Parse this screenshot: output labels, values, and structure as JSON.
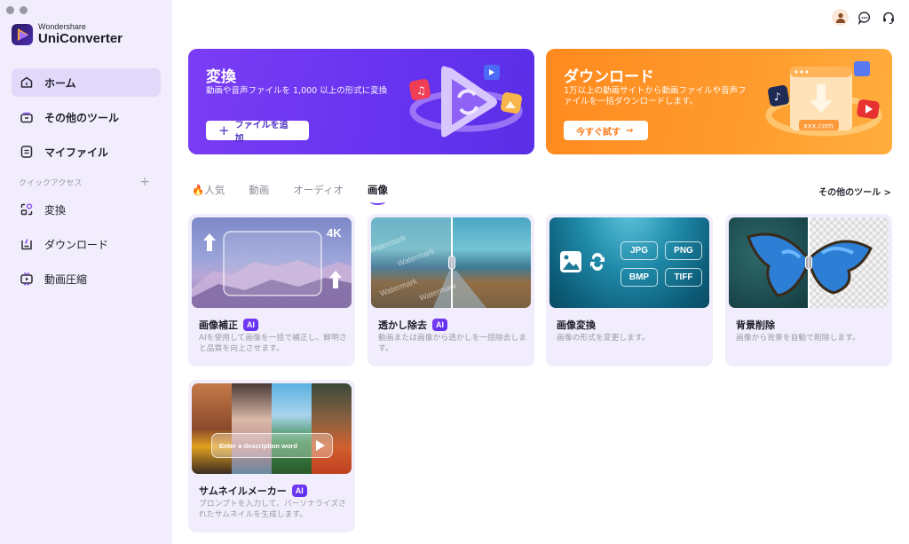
{
  "app": {
    "brand_sub": "Wondershare",
    "brand_main": "UniConverter"
  },
  "sidebar": {
    "items": [
      {
        "label": "ホーム",
        "icon": "home-icon",
        "active": true
      },
      {
        "label": "その他のツール",
        "icon": "toolbox-icon",
        "active": false
      },
      {
        "label": "マイファイル",
        "icon": "file-icon",
        "active": false
      }
    ],
    "quick_access_label": "クイックアクセス",
    "quick_access_add": "+",
    "quick_items": [
      {
        "label": "変換",
        "icon": "convert-icon"
      },
      {
        "label": "ダウンロード",
        "icon": "download-icon"
      },
      {
        "label": "動画圧縮",
        "icon": "compress-icon"
      }
    ]
  },
  "header": {
    "icons": [
      "avatar-icon",
      "chat-icon",
      "headset-icon"
    ]
  },
  "banners": {
    "convert": {
      "title": "変換",
      "desc": "動画や音声ファイルを 1,000 以上の形式に変換",
      "button": "ファイルを追加",
      "button_icon": "+"
    },
    "download": {
      "title": "ダウンロード",
      "desc": "1万以上の動画サイトから動画ファイルや音声ファイルを一括ダウンロードします。",
      "button": "今すぐ試す",
      "button_icon": "→",
      "art_label": "xxx.com"
    }
  },
  "tabs": {
    "items": [
      {
        "label": "🔥人気",
        "active": false
      },
      {
        "label": "動画",
        "active": false
      },
      {
        "label": "オーディオ",
        "active": false
      },
      {
        "label": "画像",
        "active": true
      }
    ],
    "more_tools": "その他のツール >"
  },
  "cards": [
    {
      "title": "画像補正",
      "ai": true,
      "badge": "AI",
      "desc": "AIを使用して画像を一括で補正し、鮮明さと品質を向上させます。",
      "img_label": "4K"
    },
    {
      "title": "透かし除去",
      "ai": true,
      "badge": "AI",
      "desc": "動画または画像から透かしを一括除去します。",
      "img_label": "Watermark"
    },
    {
      "title": "画像変換",
      "ai": false,
      "desc": "画像の形式を変更します。",
      "formats": [
        "JPG",
        "PNG",
        "BMP",
        "TIFF"
      ]
    },
    {
      "title": "背景削除",
      "ai": false,
      "desc": "画像から背景を自動で削除します。"
    },
    {
      "title": "サムネイルメーカー",
      "ai": true,
      "badge": "AI",
      "desc": "プロンプトを入力して、パーソナライズされたサムネイルを生成します。",
      "img_label": "Enter a description word"
    }
  ],
  "colors": {
    "accent": "#6c3ef4",
    "convert_banner": "#6a35f2",
    "download_banner": "#ff9326",
    "sidebar_bg": "#f1edfc",
    "card_bg": "#f1edfc"
  }
}
